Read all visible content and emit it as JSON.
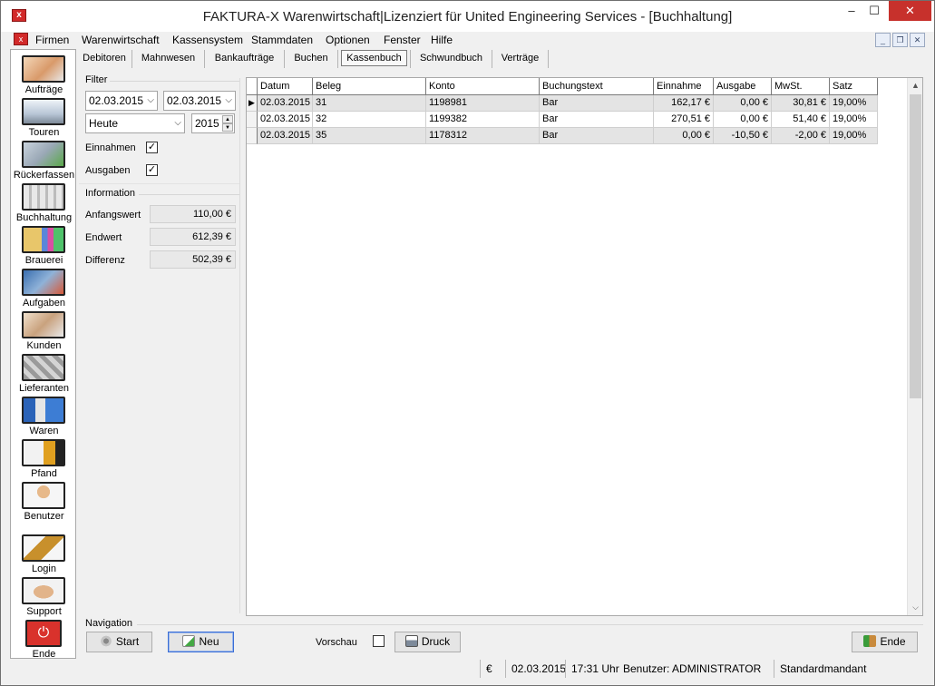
{
  "window": {
    "title": "FAKTURA-X Warenwirtschaft|Lizenziert für United Engineering Services - [Buchhaltung]",
    "minimize_glyph": "–",
    "maximize_glyph": "☐",
    "close_glyph": "✕"
  },
  "menu": {
    "items": [
      "Firmen",
      "Warenwirtschaft",
      "Kassensystem",
      "Stammdaten",
      "Optionen",
      "Fenster",
      "Hilfe"
    ]
  },
  "sidebar": {
    "items": [
      {
        "label": "Aufträge",
        "icon": "phone-operator-icon"
      },
      {
        "label": "Touren",
        "icon": "truck-icon"
      },
      {
        "label": "Rückerfassen",
        "icon": "truck-return-icon"
      },
      {
        "label": "Buchhaltung",
        "icon": "money-icon"
      },
      {
        "label": "Brauerei",
        "icon": "brewery-chart-icon"
      },
      {
        "label": "Aufgaben",
        "icon": "tasks-icon"
      },
      {
        "label": "Kunden",
        "icon": "customers-icon"
      },
      {
        "label": "Lieferanten",
        "icon": "suppliers-icon"
      },
      {
        "label": "Waren",
        "icon": "goods-icon"
      },
      {
        "label": "Pfand",
        "icon": "deposit-icon"
      },
      {
        "label": "Benutzer",
        "icon": "user-lock-icon"
      },
      {
        "label": "Login",
        "icon": "key-icon"
      },
      {
        "label": "Support",
        "icon": "handshake-icon"
      },
      {
        "label": "Ende",
        "icon": "power-icon"
      }
    ],
    "colors": {
      "power": "#d9322c"
    }
  },
  "tabs": {
    "items": [
      "Debitoren",
      "Mahnwesen",
      "Bankaufträge",
      "Buchen",
      "Kassenbuch",
      "Schwundbuch",
      "Verträge"
    ],
    "active": "Kassenbuch"
  },
  "filter": {
    "title": "Filter",
    "date_from": "02.03.2015",
    "date_to": "02.03.2015",
    "period": "Heute",
    "year": "2015",
    "einnahmen_label": "Einnahmen",
    "einnahmen_checked": "✓",
    "ausgaben_label": "Ausgaben",
    "ausgaben_checked": "✓"
  },
  "information": {
    "title": "Information",
    "anfangswert_label": "Anfangswert",
    "anfangswert": "110,00 €",
    "endwert_label": "Endwert",
    "endwert": "612,39 €",
    "differenz_label": "Differenz",
    "differenz": "502,39 €"
  },
  "grid": {
    "columns": [
      "Datum",
      "Beleg",
      "Konto",
      "Buchungstext",
      "Einnahme",
      "Ausgabe",
      "MwSt.",
      "Satz"
    ],
    "current_row_marker": "▶",
    "rows": [
      [
        "02.03.2015",
        "31",
        "1198981",
        "Bar",
        "162,17 €",
        "0,00 €",
        "30,81 €",
        "19,00%"
      ],
      [
        "02.03.2015",
        "32",
        "1199382",
        "Bar",
        "270,51 €",
        "0,00 €",
        "51,40 €",
        "19,00%"
      ],
      [
        "02.03.2015",
        "35",
        "1178312",
        "Bar",
        "0,00 €",
        "-10,50 €",
        "-2,00 €",
        "19,00%"
      ]
    ]
  },
  "navigation": {
    "title": "Navigation",
    "start_label": "Start",
    "neu_label": "Neu",
    "vorschau_label": "Vorschau",
    "druck_label": "Druck",
    "ende_label": "Ende"
  },
  "status": {
    "currency": "€",
    "date": "02.03.2015",
    "time": "17:31 Uhr",
    "user": "Benutzer: ADMINISTRATOR",
    "mandant": "Standardmandant"
  }
}
